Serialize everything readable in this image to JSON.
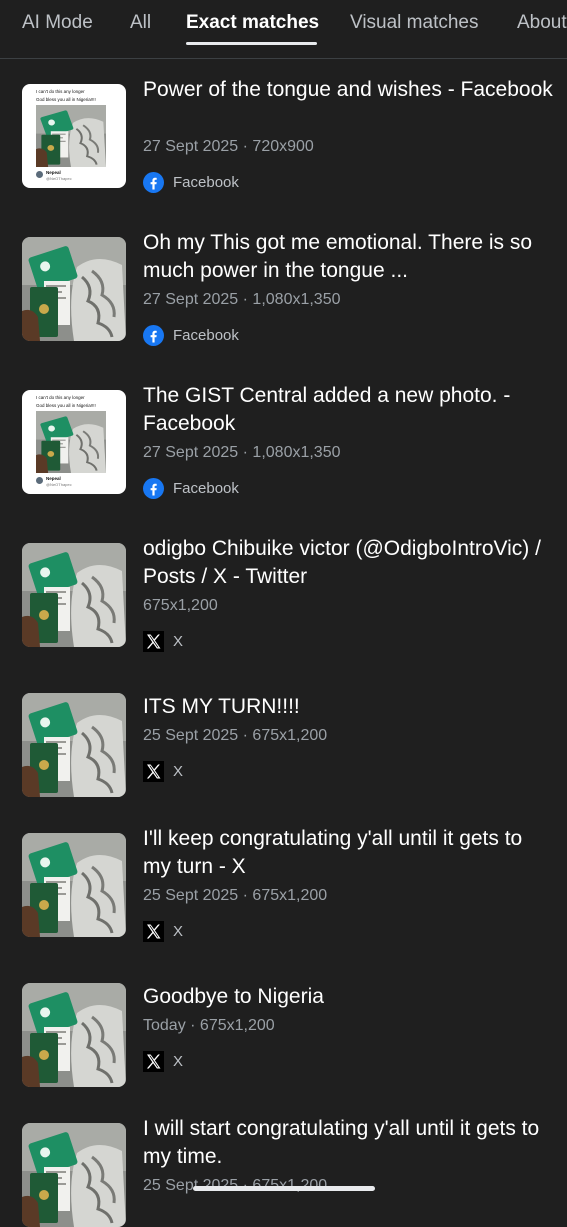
{
  "tabs": [
    {
      "label": "AI Mode"
    },
    {
      "label": "All"
    },
    {
      "label": "Exact matches"
    },
    {
      "label": "Visual matches"
    },
    {
      "label": "About"
    }
  ],
  "results": [
    {
      "title": "Power of the tongue and wishes - Facebook",
      "date": "27 Sept 2025",
      "size": "720x900",
      "source": "Facebook",
      "source_icon": "facebook-icon",
      "thumb_style": "tweet"
    },
    {
      "title": "Oh my This got me emotional. There is so much power in the tongue ...",
      "date": "27 Sept 2025",
      "size": "1,080x1,350",
      "source": "Facebook",
      "source_icon": "facebook-icon",
      "thumb_style": "photo"
    },
    {
      "title": "The GIST Central added a new photo. - Facebook",
      "date": "27 Sept 2025",
      "size": "1,080x1,350",
      "source": "Facebook",
      "source_icon": "facebook-icon",
      "thumb_style": "tweet"
    },
    {
      "title": "odigbo Chibuike victor (@OdigboIntroVic) / Posts / X - Twitter",
      "date": "",
      "size": "675x1,200",
      "source": "X",
      "source_icon": "x-icon",
      "thumb_style": "photo"
    },
    {
      "title": "ITS MY TURN!!!!",
      "date": "25 Sept 2025",
      "size": "675x1,200",
      "source": "X",
      "source_icon": "x-icon",
      "thumb_style": "photo"
    },
    {
      "title": "I'll keep congratulating y'all until it gets to my turn - X",
      "date": "25 Sept 2025",
      "size": "675x1,200",
      "source": "X",
      "source_icon": "x-icon",
      "thumb_style": "photo"
    },
    {
      "title": "Goodbye to Nigeria",
      "date": "Today",
      "size": "675x1,200",
      "source": "X",
      "source_icon": "x-icon",
      "thumb_style": "photo"
    },
    {
      "title": "I will start congratulating y'all until it gets to my time.",
      "date": "25 Sept 2025",
      "size": "675x1,200",
      "source": "",
      "source_icon": "",
      "thumb_style": "photo"
    }
  ],
  "tweet_thumb": {
    "line1": "I can't do this any longer",
    "line2": "God bless you all in Nigeria!!!!",
    "author": "Nepeal",
    "handle": "@NeOThapec"
  },
  "colors": {
    "background": "#1f1f1f",
    "text": "#ffffff",
    "meta": "#9aa0a6",
    "facebook": "#1877f2",
    "passport": "#1f5a36",
    "card_green": "#1e8f63"
  }
}
